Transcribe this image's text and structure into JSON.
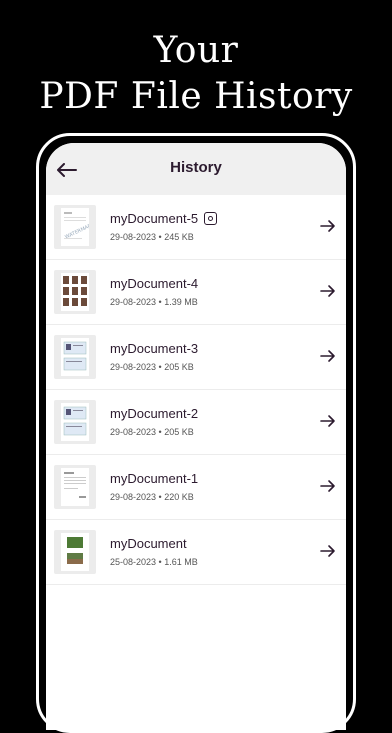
{
  "headline": {
    "line1": "Your",
    "line2": "PDF File History"
  },
  "appbar": {
    "title": "History",
    "back_icon": "arrow-left-icon"
  },
  "files": [
    {
      "name": "myDocument-5",
      "meta": "29-08-2023 • 245 KB",
      "thumb": "watermark-doc",
      "badge": "lock-badge-icon"
    },
    {
      "name": "myDocument-4",
      "meta": "29-08-2023 • 1.39 MB",
      "thumb": "photo-grid"
    },
    {
      "name": "myDocument-3",
      "meta": "29-08-2023 • 205 KB",
      "thumb": "id-card"
    },
    {
      "name": "myDocument-2",
      "meta": "29-08-2023 • 205 KB",
      "thumb": "id-card"
    },
    {
      "name": "myDocument-1",
      "meta": "29-08-2023 • 220 KB",
      "thumb": "invoice"
    },
    {
      "name": "myDocument",
      "meta": "25-08-2023 • 1.61 MB",
      "thumb": "landscape-photos"
    }
  ],
  "colors": {
    "background": "#000000",
    "appbar": "#f0f0f0",
    "text_primary": "#2c1b2f"
  }
}
